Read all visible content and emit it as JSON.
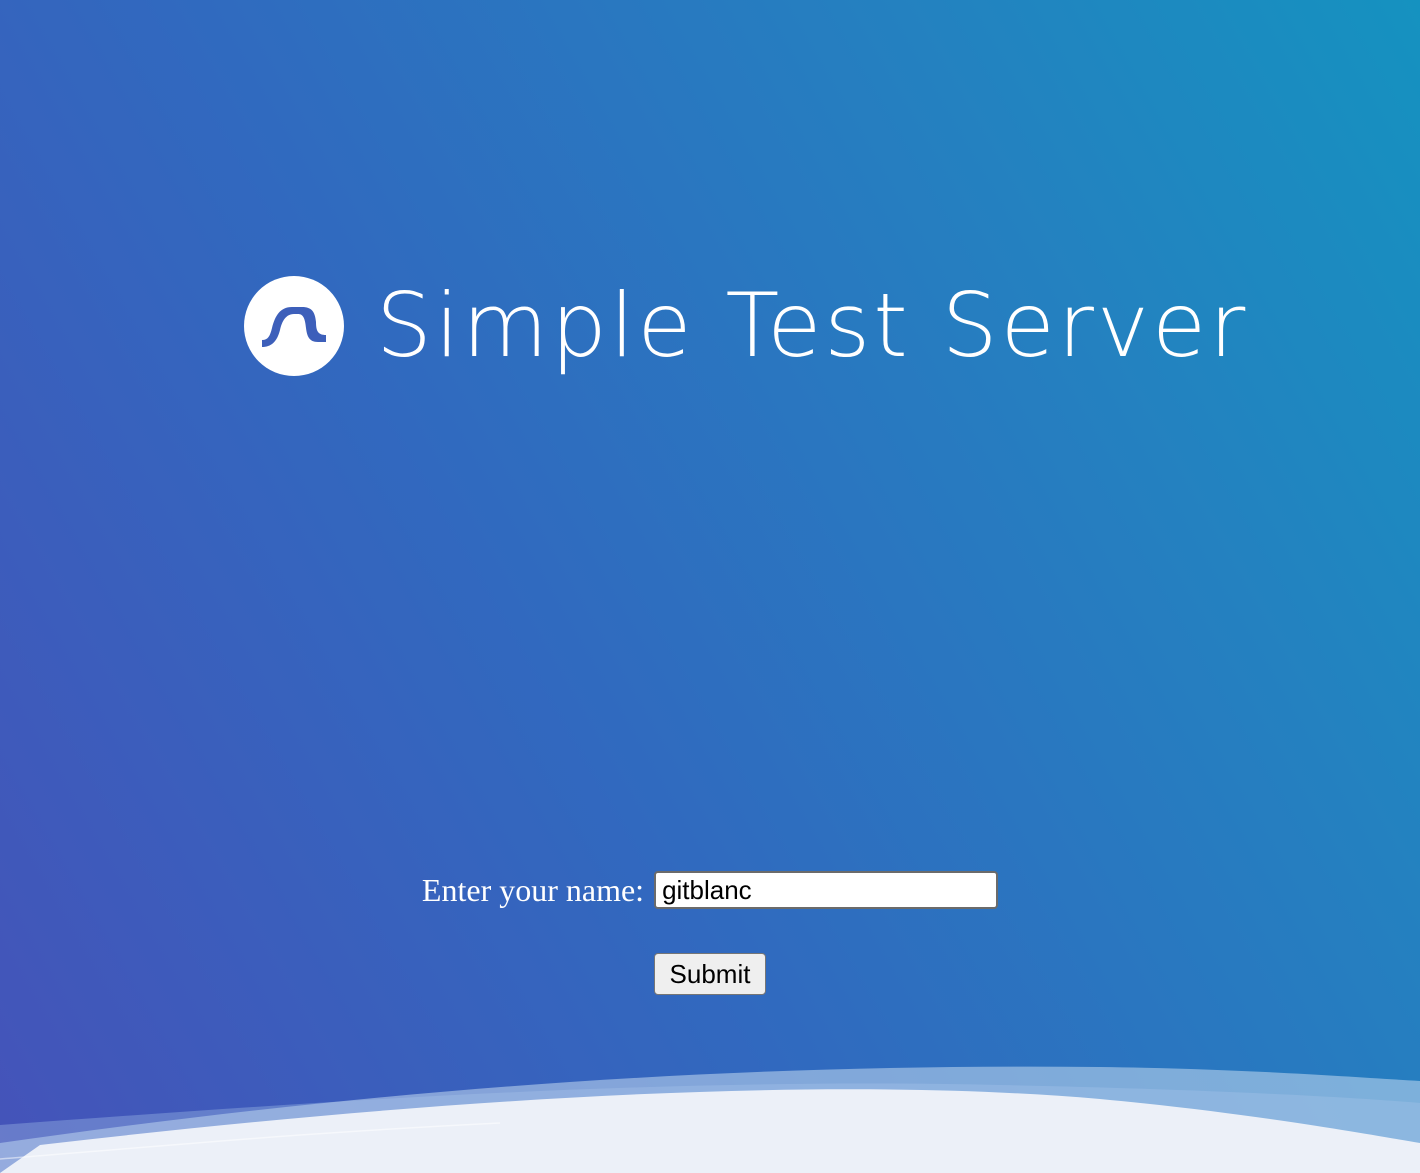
{
  "brand": {
    "logo_icon": "wave-logo-icon",
    "title": "Simple Test Server"
  },
  "form": {
    "label": "Enter your name:",
    "name_value": "gitblanc",
    "submit_label": "Submit"
  },
  "colors": {
    "background_start": "#4553b9",
    "background_end": "#1592c0",
    "wave_light": "#ecf0f8",
    "wave_mid": "#c4daf0"
  }
}
